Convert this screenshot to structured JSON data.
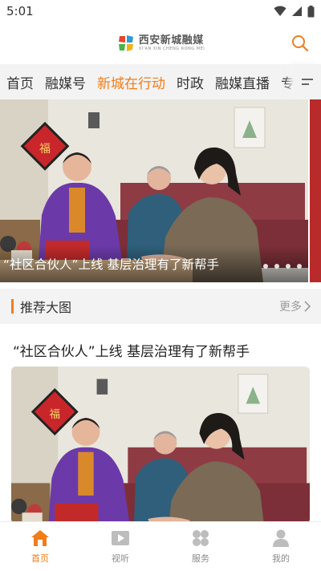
{
  "status_bar": {
    "time": "5:01"
  },
  "header": {
    "app_name": "西安新城融媒",
    "app_name_en": "XI'AN XIN CHENG RONG MEI"
  },
  "channels": [
    {
      "label": "首页",
      "active": false
    },
    {
      "label": "融媒号",
      "active": false
    },
    {
      "label": "新城在行动",
      "active": true
    },
    {
      "label": "时政",
      "active": false
    },
    {
      "label": "融媒直播",
      "active": false
    },
    {
      "label": "专",
      "active": false
    }
  ],
  "banner": {
    "caption": "“社区合伙人”上线  基层治理有了新帮手",
    "dot_count": 4
  },
  "section": {
    "title": "推荐大图",
    "more_label": "更多"
  },
  "article": {
    "title": "“社区合伙人”上线  基层治理有了新帮手"
  },
  "bottom_nav": [
    {
      "label": "首页",
      "icon": "home-icon",
      "active": true
    },
    {
      "label": "视听",
      "icon": "video-icon",
      "active": false
    },
    {
      "label": "服务",
      "icon": "services-grid-icon",
      "active": false
    },
    {
      "label": "我的",
      "icon": "profile-icon",
      "active": false
    }
  ],
  "colors": {
    "accent": "#f07d1a",
    "tab_bar_bg": "#f3f3f3",
    "muted_text": "#8a8a8a"
  }
}
